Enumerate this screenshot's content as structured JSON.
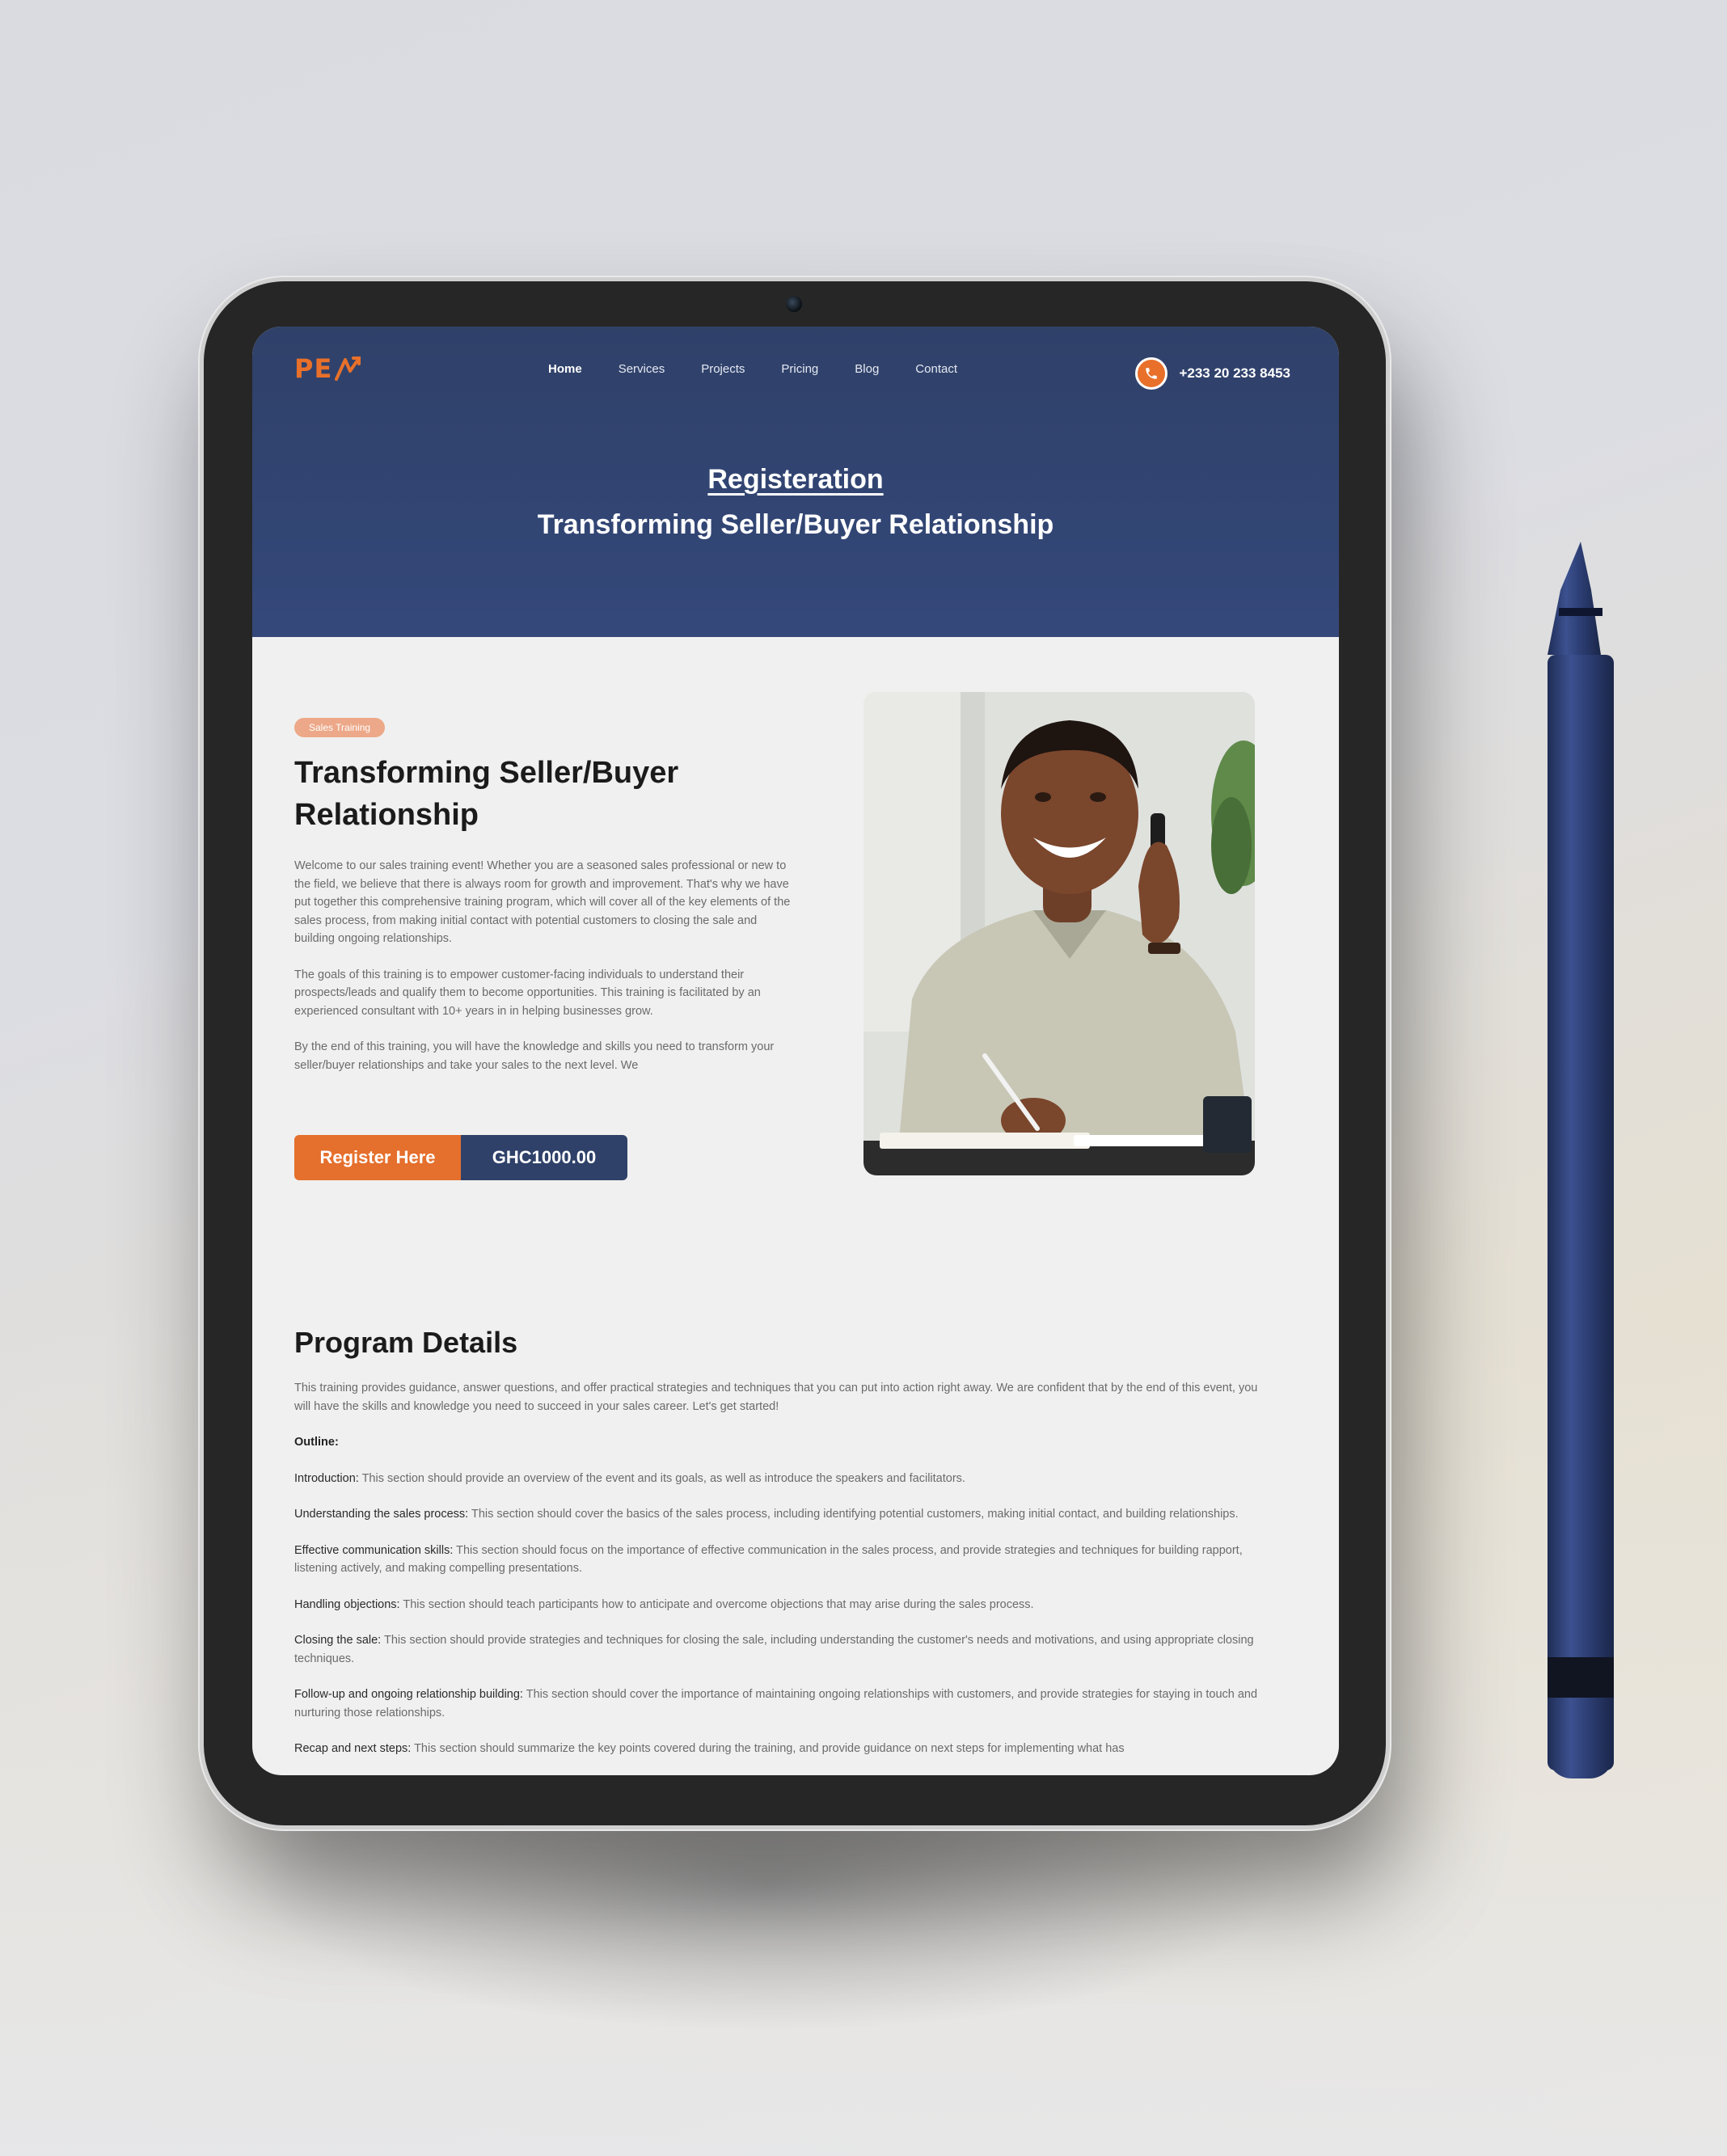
{
  "header": {
    "logo_text": "PE",
    "nav": [
      {
        "label": "Home",
        "active": true
      },
      {
        "label": "Services"
      },
      {
        "label": "Projects"
      },
      {
        "label": "Pricing"
      },
      {
        "label": "Blog"
      },
      {
        "label": "Contact"
      }
    ],
    "phone": "+233 20 233 8453",
    "phone_icon": "phone-icon"
  },
  "hero": {
    "title": "Registeration",
    "subtitle": "Transforming Seller/Buyer Relationship"
  },
  "intro": {
    "badge": "Sales Training",
    "title": "Transforming Seller/Buyer Relationship",
    "paragraphs": [
      "Welcome to our sales training event! Whether you are a seasoned sales professional or new to the field, we believe that there is always room for growth and improvement. That's why we have put together this comprehensive training program, which will cover all of the key elements of the sales process, from making initial contact with potential customers to closing the sale and building ongoing relationships.",
      "The goals of this training is to empower customer-facing individuals to understand their prospects/leads and qualify them to become opportunities. This training is facilitated by an experienced consultant with 10+ years in in helping businesses grow.",
      "By the end of this training, you will have the knowledge and skills you need to transform your seller/buyer relationships and take your sales to the next level. We"
    ],
    "register_label": "Register Here",
    "price": "GHC1000.00"
  },
  "program": {
    "title": "Program Details",
    "intro": "This training provides guidance, answer questions, and offer practical strategies and techniques that you can put into action right away. We are confident that by the end of this event, you will have the skills and knowledge you need to succeed in your sales career. Let's get started!",
    "outline_label": "Outline:",
    "items": [
      {
        "term": "Introduction:",
        "text": " This section should provide an overview of the event and its goals, as well as introduce the speakers and facilitators."
      },
      {
        "term": "Understanding the sales process:",
        "text": " This section should cover the basics of the sales process, including identifying potential customers, making initial contact, and building relationships."
      },
      {
        "term": "Effective communication skills:",
        "text": " This section should focus on the importance of effective communication in the sales process, and provide strategies and techniques for building rapport, listening actively, and making compelling presentations."
      },
      {
        "term": "Handling objections:",
        "text": " This section should teach participants how to anticipate and overcome objections that may arise during the sales process."
      },
      {
        "term": "Closing the sale:",
        "text": " This section should provide strategies and techniques for closing the sale, including understanding the customer's needs and motivations, and using appropriate closing techniques."
      },
      {
        "term": "Follow-up and ongoing relationship building:",
        "text": " This section should cover the importance of maintaining ongoing relationships with customers, and provide strategies for staying in touch and nurturing those relationships."
      },
      {
        "term": "Recap and next steps:",
        "text": " This section should summarize the key points covered during the training, and provide guidance on next steps for implementing what has"
      }
    ]
  },
  "colors": {
    "accent": "#e56f2c",
    "navy": "#2f4169",
    "badge": "#eca888"
  }
}
